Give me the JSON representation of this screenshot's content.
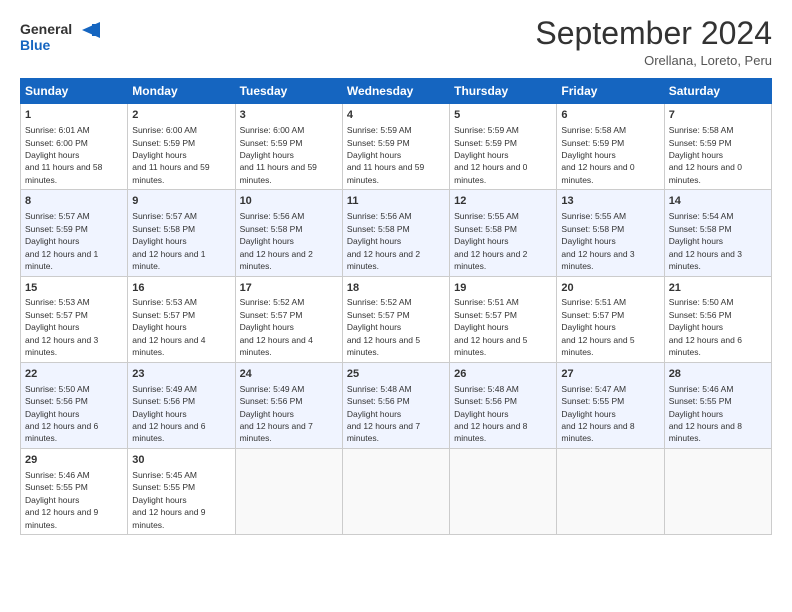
{
  "header": {
    "logo_line1": "General",
    "logo_line2": "Blue",
    "month": "September 2024",
    "location": "Orellana, Loreto, Peru"
  },
  "weekdays": [
    "Sunday",
    "Monday",
    "Tuesday",
    "Wednesday",
    "Thursday",
    "Friday",
    "Saturday"
  ],
  "weeks": [
    [
      {
        "day": "1",
        "rise": "6:01 AM",
        "set": "6:00 PM",
        "hours": "11 hours and 58 minutes."
      },
      {
        "day": "2",
        "rise": "6:00 AM",
        "set": "5:59 PM",
        "hours": "11 hours and 59 minutes."
      },
      {
        "day": "3",
        "rise": "6:00 AM",
        "set": "5:59 PM",
        "hours": "11 hours and 59 minutes."
      },
      {
        "day": "4",
        "rise": "5:59 AM",
        "set": "5:59 PM",
        "hours": "11 hours and 59 minutes."
      },
      {
        "day": "5",
        "rise": "5:59 AM",
        "set": "5:59 PM",
        "hours": "12 hours and 0 minutes."
      },
      {
        "day": "6",
        "rise": "5:58 AM",
        "set": "5:59 PM",
        "hours": "12 hours and 0 minutes."
      },
      {
        "day": "7",
        "rise": "5:58 AM",
        "set": "5:59 PM",
        "hours": "12 hours and 0 minutes."
      }
    ],
    [
      {
        "day": "8",
        "rise": "5:57 AM",
        "set": "5:59 PM",
        "hours": "12 hours and 1 minute."
      },
      {
        "day": "9",
        "rise": "5:57 AM",
        "set": "5:58 PM",
        "hours": "12 hours and 1 minute."
      },
      {
        "day": "10",
        "rise": "5:56 AM",
        "set": "5:58 PM",
        "hours": "12 hours and 2 minutes."
      },
      {
        "day": "11",
        "rise": "5:56 AM",
        "set": "5:58 PM",
        "hours": "12 hours and 2 minutes."
      },
      {
        "day": "12",
        "rise": "5:55 AM",
        "set": "5:58 PM",
        "hours": "12 hours and 2 minutes."
      },
      {
        "day": "13",
        "rise": "5:55 AM",
        "set": "5:58 PM",
        "hours": "12 hours and 3 minutes."
      },
      {
        "day": "14",
        "rise": "5:54 AM",
        "set": "5:58 PM",
        "hours": "12 hours and 3 minutes."
      }
    ],
    [
      {
        "day": "15",
        "rise": "5:53 AM",
        "set": "5:57 PM",
        "hours": "12 hours and 3 minutes."
      },
      {
        "day": "16",
        "rise": "5:53 AM",
        "set": "5:57 PM",
        "hours": "12 hours and 4 minutes."
      },
      {
        "day": "17",
        "rise": "5:52 AM",
        "set": "5:57 PM",
        "hours": "12 hours and 4 minutes."
      },
      {
        "day": "18",
        "rise": "5:52 AM",
        "set": "5:57 PM",
        "hours": "12 hours and 5 minutes."
      },
      {
        "day": "19",
        "rise": "5:51 AM",
        "set": "5:57 PM",
        "hours": "12 hours and 5 minutes."
      },
      {
        "day": "20",
        "rise": "5:51 AM",
        "set": "5:57 PM",
        "hours": "12 hours and 5 minutes."
      },
      {
        "day": "21",
        "rise": "5:50 AM",
        "set": "5:56 PM",
        "hours": "12 hours and 6 minutes."
      }
    ],
    [
      {
        "day": "22",
        "rise": "5:50 AM",
        "set": "5:56 PM",
        "hours": "12 hours and 6 minutes."
      },
      {
        "day": "23",
        "rise": "5:49 AM",
        "set": "5:56 PM",
        "hours": "12 hours and 6 minutes."
      },
      {
        "day": "24",
        "rise": "5:49 AM",
        "set": "5:56 PM",
        "hours": "12 hours and 7 minutes."
      },
      {
        "day": "25",
        "rise": "5:48 AM",
        "set": "5:56 PM",
        "hours": "12 hours and 7 minutes."
      },
      {
        "day": "26",
        "rise": "5:48 AM",
        "set": "5:56 PM",
        "hours": "12 hours and 8 minutes."
      },
      {
        "day": "27",
        "rise": "5:47 AM",
        "set": "5:55 PM",
        "hours": "12 hours and 8 minutes."
      },
      {
        "day": "28",
        "rise": "5:46 AM",
        "set": "5:55 PM",
        "hours": "12 hours and 8 minutes."
      }
    ],
    [
      {
        "day": "29",
        "rise": "5:46 AM",
        "set": "5:55 PM",
        "hours": "12 hours and 9 minutes."
      },
      {
        "day": "30",
        "rise": "5:45 AM",
        "set": "5:55 PM",
        "hours": "12 hours and 9 minutes."
      },
      null,
      null,
      null,
      null,
      null
    ]
  ]
}
